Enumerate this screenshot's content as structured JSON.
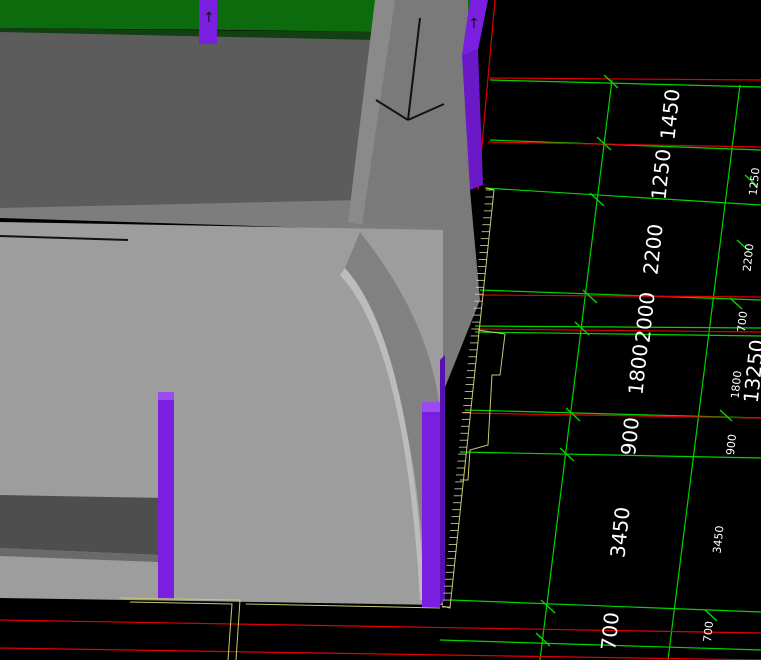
{
  "scene": {
    "colors": {
      "background": "#000000",
      "grid_green": "#00d400",
      "grid_red": "#e00000",
      "outline_yellow": "#c8c870",
      "column_purple": "#7a1fe0",
      "wall_gray": "#6f6f6f",
      "floor_gray": "#9a9a9a",
      "green_slab": "#0c6b0c"
    },
    "dimensions_large": [
      "1450",
      "1250",
      "2200",
      "2000",
      "1800",
      "900",
      "3450",
      "700"
    ],
    "dimensions_small": [
      "1250",
      "2200",
      "700",
      "1800",
      "900",
      "3450",
      "700"
    ],
    "overall_dimension": "13250",
    "axis_markers": [
      "↑",
      "↑"
    ]
  }
}
